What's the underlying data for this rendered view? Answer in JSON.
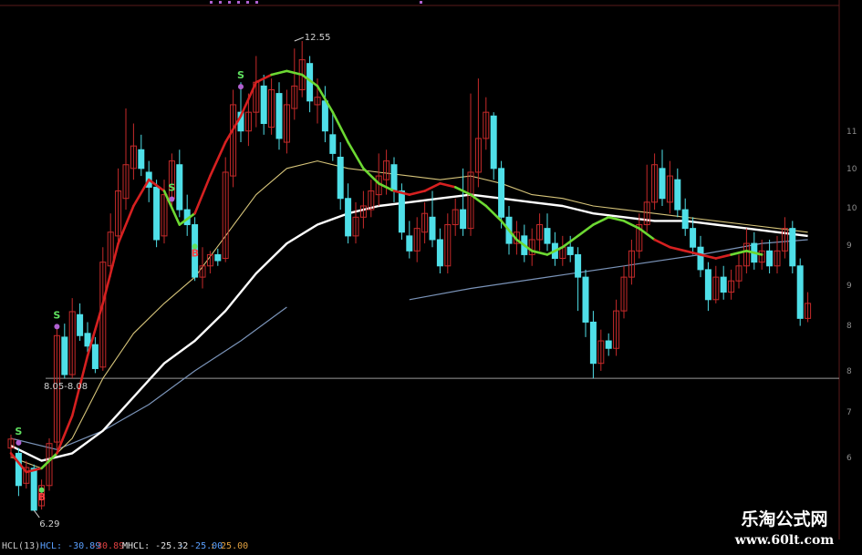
{
  "chart_data": {
    "type": "candlestick",
    "colors": {
      "up": "#c62a2a",
      "down": "#4fdfe8",
      "background": "#000000",
      "trend_up": "#d62020",
      "trend_down": "#6cd832",
      "ma_white": "#ffffff",
      "ma_yellow": "#d6c47a",
      "ma_blue": "#7a93b8",
      "hline": "#9a9a9a",
      "signal_s": "#5fe05f",
      "signal_b": "#ff4040",
      "purple_marks": "#b060d0"
    },
    "ylim": [
      5.9,
      13.0
    ],
    "hline_value": 8.05,
    "y_tick_labels": [
      "11",
      "10",
      "10",
      "9",
      "9",
      "8",
      "8",
      "7",
      "6"
    ],
    "candles": [
      [
        7.12,
        7.24,
        6.98,
        7.3
      ],
      [
        7.05,
        6.62,
        6.48,
        7.12
      ],
      [
        6.65,
        6.86,
        6.58,
        6.95
      ],
      [
        6.85,
        6.29,
        6.29,
        6.9
      ],
      [
        6.35,
        6.62,
        6.3,
        6.7
      ],
      [
        6.62,
        7.18,
        6.55,
        7.25
      ],
      [
        7.2,
        8.62,
        7.1,
        8.72
      ],
      [
        8.6,
        8.1,
        8.05,
        8.78
      ],
      [
        8.1,
        8.94,
        8.05,
        9.12
      ],
      [
        8.9,
        8.62,
        8.55,
        9.05
      ],
      [
        8.65,
        8.48,
        8.4,
        8.8
      ],
      [
        8.5,
        8.18,
        8.12,
        8.6
      ],
      [
        8.2,
        9.6,
        8.15,
        9.8
      ],
      [
        9.55,
        10.0,
        9.4,
        10.25
      ],
      [
        9.95,
        10.55,
        9.85,
        10.85
      ],
      [
        10.45,
        10.9,
        10.3,
        11.65
      ],
      [
        10.85,
        11.15,
        10.7,
        11.45
      ],
      [
        11.1,
        10.85,
        10.75,
        11.3
      ],
      [
        10.8,
        10.6,
        10.4,
        10.95
      ],
      [
        10.6,
        9.9,
        9.8,
        10.7
      ],
      [
        9.95,
        10.5,
        9.85,
        10.7
      ],
      [
        10.45,
        10.95,
        10.3,
        11.05
      ],
      [
        10.9,
        10.3,
        10.2,
        11.1
      ],
      [
        10.3,
        10.1,
        9.95,
        10.5
      ],
      [
        10.1,
        9.4,
        9.35,
        10.2
      ],
      [
        9.4,
        9.55,
        9.25,
        9.8
      ],
      [
        9.55,
        9.7,
        9.45,
        9.75
      ],
      [
        9.7,
        9.62,
        9.55,
        9.78
      ],
      [
        9.65,
        10.8,
        9.6,
        11.0
      ],
      [
        10.75,
        11.7,
        10.6,
        11.9
      ],
      [
        11.6,
        11.35,
        11.2,
        12.0
      ],
      [
        11.35,
        11.6,
        11.15,
        11.85
      ],
      [
        11.6,
        12.0,
        11.4,
        12.35
      ],
      [
        11.95,
        11.45,
        11.3,
        12.1
      ],
      [
        11.4,
        11.9,
        11.3,
        12.05
      ],
      [
        11.85,
        11.25,
        11.1,
        12.0
      ],
      [
        11.2,
        11.7,
        11.05,
        11.9
      ],
      [
        11.65,
        11.95,
        11.5,
        12.45
      ],
      [
        11.9,
        12.3,
        11.8,
        12.55
      ],
      [
        12.25,
        11.75,
        11.6,
        12.35
      ],
      [
        11.7,
        11.8,
        11.45,
        12.05
      ],
      [
        11.75,
        11.35,
        11.2,
        11.95
      ],
      [
        11.3,
        11.05,
        10.95,
        11.6
      ],
      [
        11.0,
        10.45,
        10.3,
        11.2
      ],
      [
        10.45,
        9.95,
        9.85,
        10.65
      ],
      [
        9.95,
        10.2,
        9.85,
        10.4
      ],
      [
        10.2,
        10.35,
        10.05,
        10.55
      ],
      [
        10.3,
        10.55,
        10.2,
        10.7
      ],
      [
        10.5,
        10.75,
        10.35,
        11.05
      ],
      [
        10.7,
        10.95,
        10.5,
        11.1
      ],
      [
        10.9,
        10.55,
        10.4,
        11.0
      ],
      [
        10.55,
        10.0,
        9.9,
        10.65
      ],
      [
        9.95,
        9.75,
        9.65,
        10.15
      ],
      [
        9.75,
        10.05,
        9.6,
        10.2
      ],
      [
        10.0,
        10.25,
        9.85,
        10.4
      ],
      [
        10.2,
        9.9,
        9.8,
        10.55
      ],
      [
        9.9,
        9.55,
        9.45,
        10.05
      ],
      [
        9.55,
        10.1,
        9.45,
        10.25
      ],
      [
        10.1,
        10.3,
        9.95,
        10.45
      ],
      [
        10.3,
        10.05,
        9.95,
        10.85
      ],
      [
        10.05,
        10.8,
        9.95,
        11.85
      ],
      [
        10.8,
        11.25,
        10.6,
        12.05
      ],
      [
        11.25,
        11.6,
        11.1,
        11.8
      ],
      [
        11.55,
        10.85,
        10.7,
        11.6
      ],
      [
        10.85,
        10.2,
        10.05,
        10.95
      ],
      [
        10.2,
        9.85,
        9.7,
        10.35
      ],
      [
        9.85,
        10.0,
        9.7,
        10.15
      ],
      [
        9.95,
        9.7,
        9.6,
        10.1
      ],
      [
        9.7,
        9.9,
        9.55,
        10.05
      ],
      [
        9.9,
        10.1,
        9.75,
        10.25
      ],
      [
        10.05,
        9.85,
        9.75,
        10.25
      ],
      [
        9.85,
        9.65,
        9.55,
        10.0
      ],
      [
        9.65,
        9.8,
        9.55,
        9.95
      ],
      [
        9.8,
        9.7,
        9.6,
        9.95
      ],
      [
        9.7,
        9.4,
        8.95,
        9.8
      ],
      [
        9.4,
        8.8,
        8.6,
        9.5
      ],
      [
        8.8,
        8.25,
        8.05,
        8.95
      ],
      [
        8.25,
        8.55,
        8.15,
        8.7
      ],
      [
        8.55,
        8.45,
        8.35,
        8.65
      ],
      [
        8.45,
        8.95,
        8.35,
        9.1
      ],
      [
        8.95,
        9.4,
        8.85,
        9.55
      ],
      [
        9.4,
        9.75,
        9.3,
        9.9
      ],
      [
        9.75,
        10.1,
        9.65,
        10.25
      ],
      [
        10.1,
        10.4,
        10.0,
        10.9
      ],
      [
        10.4,
        10.9,
        10.3,
        11.05
      ],
      [
        10.85,
        10.45,
        10.35,
        11.1
      ],
      [
        10.4,
        10.75,
        10.25,
        10.95
      ],
      [
        10.7,
        10.3,
        10.2,
        10.85
      ],
      [
        10.3,
        10.05,
        9.95,
        10.45
      ],
      [
        10.05,
        9.8,
        9.7,
        10.2
      ],
      [
        9.8,
        9.5,
        9.4,
        9.95
      ],
      [
        9.5,
        9.1,
        8.95,
        9.6
      ],
      [
        9.1,
        9.4,
        9.05,
        9.55
      ],
      [
        9.4,
        9.2,
        9.1,
        9.55
      ],
      [
        9.2,
        9.35,
        9.1,
        9.5
      ],
      [
        9.35,
        9.55,
        9.25,
        9.7
      ],
      [
        9.55,
        9.85,
        9.45,
        10.05
      ],
      [
        9.85,
        9.6,
        9.5,
        10.0
      ],
      [
        9.6,
        9.75,
        9.5,
        9.9
      ],
      [
        9.75,
        9.55,
        9.45,
        9.9
      ],
      [
        9.55,
        9.75,
        9.45,
        9.95
      ],
      [
        9.75,
        10.05,
        9.65,
        10.2
      ],
      [
        10.05,
        9.55,
        9.45,
        10.15
      ],
      [
        9.55,
        8.85,
        8.75,
        9.65
      ],
      [
        8.85,
        9.05,
        8.8,
        9.2
      ]
    ],
    "trend_line": [
      [
        0,
        7.05
      ],
      [
        2,
        6.8
      ],
      [
        4,
        6.85
      ],
      [
        6,
        7.05
      ],
      [
        8,
        7.55
      ],
      [
        10,
        8.35
      ],
      [
        12,
        9.05
      ],
      [
        14,
        9.85
      ],
      [
        16,
        10.35
      ],
      [
        18,
        10.7
      ],
      [
        20,
        10.55
      ],
      [
        22,
        10.1
      ],
      [
        24,
        10.25
      ],
      [
        26,
        10.75
      ],
      [
        28,
        11.2
      ],
      [
        30,
        11.55
      ],
      [
        32,
        12.0
      ],
      [
        34,
        12.1
      ],
      [
        36,
        12.15
      ],
      [
        38,
        12.1
      ],
      [
        40,
        11.95
      ],
      [
        42,
        11.6
      ],
      [
        44,
        11.2
      ],
      [
        46,
        10.85
      ],
      [
        48,
        10.65
      ],
      [
        50,
        10.55
      ],
      [
        52,
        10.5
      ],
      [
        54,
        10.55
      ],
      [
        56,
        10.65
      ],
      [
        58,
        10.6
      ],
      [
        60,
        10.5
      ],
      [
        62,
        10.35
      ],
      [
        64,
        10.15
      ],
      [
        66,
        9.9
      ],
      [
        68,
        9.75
      ],
      [
        70,
        9.7
      ],
      [
        72,
        9.8
      ],
      [
        74,
        9.95
      ],
      [
        76,
        10.1
      ],
      [
        78,
        10.2
      ],
      [
        80,
        10.15
      ],
      [
        82,
        10.05
      ],
      [
        84,
        9.9
      ],
      [
        86,
        9.8
      ],
      [
        88,
        9.75
      ],
      [
        90,
        9.7
      ],
      [
        92,
        9.65
      ],
      [
        94,
        9.7
      ],
      [
        96,
        9.75
      ],
      [
        98,
        9.7
      ]
    ],
    "trend_up_segments": [
      [
        0,
        4
      ],
      [
        6,
        20
      ],
      [
        24,
        35
      ],
      [
        50,
        58
      ],
      [
        84,
        94
      ]
    ],
    "ma_white": [
      [
        0,
        7.15
      ],
      [
        4,
        6.95
      ],
      [
        8,
        7.05
      ],
      [
        12,
        7.35
      ],
      [
        16,
        7.8
      ],
      [
        20,
        8.25
      ],
      [
        24,
        8.55
      ],
      [
        28,
        8.95
      ],
      [
        32,
        9.45
      ],
      [
        36,
        9.85
      ],
      [
        40,
        10.1
      ],
      [
        44,
        10.25
      ],
      [
        48,
        10.35
      ],
      [
        52,
        10.4
      ],
      [
        56,
        10.45
      ],
      [
        60,
        10.5
      ],
      [
        64,
        10.45
      ],
      [
        68,
        10.4
      ],
      [
        72,
        10.35
      ],
      [
        76,
        10.25
      ],
      [
        80,
        10.2
      ],
      [
        84,
        10.15
      ],
      [
        88,
        10.15
      ],
      [
        92,
        10.1
      ],
      [
        96,
        10.05
      ],
      [
        100,
        10.0
      ],
      [
        104,
        9.95
      ]
    ],
    "ma_yellow": [
      [
        0,
        7.0
      ],
      [
        4,
        6.85
      ],
      [
        8,
        7.25
      ],
      [
        12,
        8.05
      ],
      [
        16,
        8.65
      ],
      [
        20,
        9.05
      ],
      [
        24,
        9.4
      ],
      [
        28,
        9.95
      ],
      [
        32,
        10.5
      ],
      [
        36,
        10.85
      ],
      [
        40,
        10.95
      ],
      [
        44,
        10.85
      ],
      [
        48,
        10.8
      ],
      [
        52,
        10.75
      ],
      [
        56,
        10.7
      ],
      [
        60,
        10.75
      ],
      [
        64,
        10.65
      ],
      [
        68,
        10.5
      ],
      [
        72,
        10.45
      ],
      [
        76,
        10.35
      ],
      [
        80,
        10.3
      ],
      [
        84,
        10.25
      ],
      [
        88,
        10.2
      ],
      [
        92,
        10.15
      ],
      [
        96,
        10.1
      ],
      [
        100,
        10.05
      ],
      [
        104,
        10.0
      ]
    ],
    "ma_blue_1": [
      [
        0,
        7.25
      ],
      [
        6,
        7.1
      ],
      [
        12,
        7.35
      ],
      [
        18,
        7.7
      ],
      [
        24,
        8.15
      ],
      [
        30,
        8.55
      ],
      [
        36,
        9.0
      ]
    ],
    "ma_blue_2": [
      [
        52,
        9.1
      ],
      [
        60,
        9.25
      ],
      [
        70,
        9.4
      ],
      [
        80,
        9.55
      ],
      [
        90,
        9.7
      ],
      [
        98,
        9.85
      ],
      [
        104,
        9.9
      ]
    ],
    "signals": [
      {
        "type": "S",
        "idx": 1,
        "value": 7.3
      },
      {
        "type": "B",
        "idx": 4,
        "value": 6.45
      },
      {
        "type": "S",
        "idx": 6,
        "value": 8.85
      },
      {
        "type": "S",
        "idx": 21,
        "value": 10.55
      },
      {
        "type": "B",
        "idx": 24,
        "value": 9.7
      },
      {
        "type": "S",
        "idx": 30,
        "value": 12.05
      }
    ],
    "annotations": {
      "high_label": "12.55",
      "low_label": "6.29",
      "range_label": "8.05-8.08"
    }
  },
  "indicator_bar": {
    "name": "HCL(13)",
    "hcl": "HCL: -30.89",
    "val2": "-30.89",
    "mhcl": "MHCL: -25.32",
    "val4": "- -25.00",
    "val5": ": 25.00"
  },
  "watermark": {
    "title": "乐淘公式网",
    "url": "www.60lt.com"
  }
}
